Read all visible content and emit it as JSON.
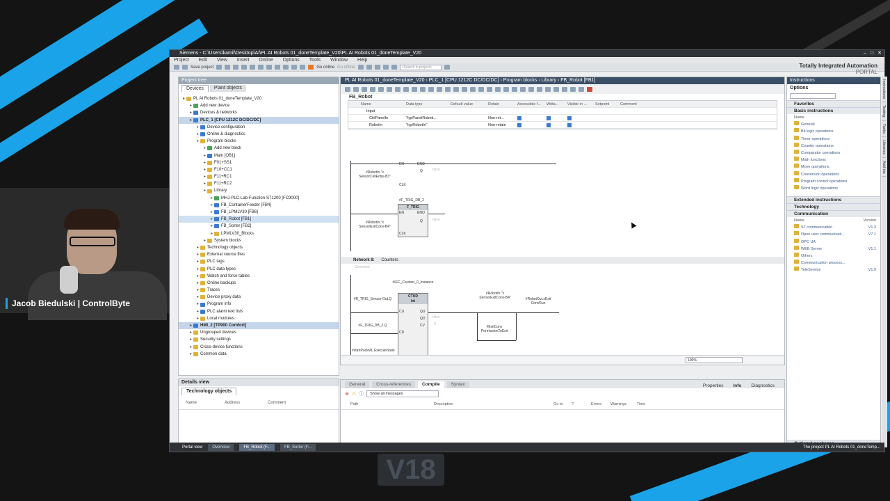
{
  "overlay": {
    "presenter": "Jacob Biedulski | ControlByte",
    "version_badge": "V18"
  },
  "window": {
    "title": "Siemens - C:\\Users\\kamil\\Desktop\\AI\\PL AI Robots 01_doneTemplate_V20\\PL AI Robots 01_doneTemplate_V20",
    "brand_line1": "Totally Integrated Automation",
    "brand_line2": "PORTAL"
  },
  "menu": [
    "Project",
    "Edit",
    "View",
    "Insert",
    "Online",
    "Options",
    "Tools",
    "Window",
    "Help"
  ],
  "toolbar": {
    "save_project": "Save project",
    "go_online": "Go online",
    "go_offline": "Go offline",
    "search_placeholder": "<Search in project>"
  },
  "project_tree": {
    "header": "Project tree",
    "tab_devices": "Devices",
    "tab_plant": "Plant objects",
    "items": [
      {
        "label": "PL AI Robots 01_doneTemplate_V20",
        "indent": 0,
        "icon": "y"
      },
      {
        "label": "Add new device",
        "indent": 1,
        "icon": "g"
      },
      {
        "label": "Devices & networks",
        "indent": 1,
        "icon": "b"
      },
      {
        "label": "PLC_1 [CPU 1212C DC/DC/DC]",
        "indent": 1,
        "icon": "b",
        "state": "hi"
      },
      {
        "label": "Device configuration",
        "indent": 2,
        "icon": "b"
      },
      {
        "label": "Online & diagnostics",
        "indent": 2,
        "icon": "b"
      },
      {
        "label": "Program blocks",
        "indent": 2,
        "icon": "y"
      },
      {
        "label": "Add new block",
        "indent": 3,
        "icon": "g"
      },
      {
        "label": "Main [OB1]",
        "indent": 3,
        "icon": "b"
      },
      {
        "label": "F01+SS1",
        "indent": 3,
        "icon": "y"
      },
      {
        "label": "F10+CC1",
        "indent": 3,
        "icon": "y"
      },
      {
        "label": "F11+RC1",
        "indent": 3,
        "icon": "y"
      },
      {
        "label": "F11+RC2",
        "indent": 3,
        "icon": "y"
      },
      {
        "label": "Library",
        "indent": 3,
        "icon": "y"
      },
      {
        "label": "MHJ-PLC-Lab-Function-S71200 [FC9000]",
        "indent": 4,
        "icon": "g"
      },
      {
        "label": "FB_ContainerFeeder [FB4]",
        "indent": 4,
        "icon": "b"
      },
      {
        "label": "FB_LPMLV30 [FB6]",
        "indent": 4,
        "icon": "b"
      },
      {
        "label": "FB_Robot [FB1]",
        "indent": 4,
        "icon": "b",
        "state": "sel"
      },
      {
        "label": "FB_Sorter [FB2]",
        "indent": 4,
        "icon": "b"
      },
      {
        "label": "LPMLV30_Blocks",
        "indent": 4,
        "icon": "y"
      },
      {
        "label": "System blocks",
        "indent": 3,
        "icon": "y"
      },
      {
        "label": "Technology objects",
        "indent": 2,
        "icon": "y"
      },
      {
        "label": "External source files",
        "indent": 2,
        "icon": "y"
      },
      {
        "label": "PLC tags",
        "indent": 2,
        "icon": "y"
      },
      {
        "label": "PLC data types",
        "indent": 2,
        "icon": "y"
      },
      {
        "label": "Watch and force tables",
        "indent": 2,
        "icon": "y"
      },
      {
        "label": "Online backups",
        "indent": 2,
        "icon": "y"
      },
      {
        "label": "Traces",
        "indent": 2,
        "icon": "y"
      },
      {
        "label": "Device proxy data",
        "indent": 2,
        "icon": "y"
      },
      {
        "label": "Program info",
        "indent": 2,
        "icon": "b"
      },
      {
        "label": "PLC alarm text lists",
        "indent": 2,
        "icon": "b"
      },
      {
        "label": "Local modules",
        "indent": 2,
        "icon": "y"
      },
      {
        "label": "HMI_2 [TP900 Comfort]",
        "indent": 1,
        "icon": "b",
        "state": "hi"
      },
      {
        "label": "Ungrouped devices",
        "indent": 1,
        "icon": "y"
      },
      {
        "label": "Security settings",
        "indent": 1,
        "icon": "y"
      },
      {
        "label": "Cross-device functions",
        "indent": 1,
        "icon": "y"
      },
      {
        "label": "Common data",
        "indent": 1,
        "icon": "y"
      }
    ]
  },
  "details_view": {
    "header": "Details view",
    "tab": "Technology objects",
    "columns": [
      "Name",
      "Address",
      "Comment"
    ]
  },
  "editor": {
    "breadcrumb": "PL AI Robots 01_doneTemplate_V20 › PLC_1 [CPU 1212C DC/DC/DC] › Program blocks › Library › FB_Robot [FB1]",
    "block_name": "FB_Robot",
    "interface_columns": [
      "Name",
      "Data type",
      "Default value",
      "Retain",
      "Accessible f...",
      "Writa...",
      "Visible in ...",
      "Setpoint",
      "Comment"
    ],
    "interface_rows": [
      {
        "name": "Input",
        "type": "",
        "retain": ""
      },
      {
        "name": "CtrlPanelIn",
        "type": "\"typPanelRoboti...",
        "retain": "Non-ret..."
      },
      {
        "name": "RobotIn",
        "type": "\"typRobotIn\"",
        "retain": "Non-retain"
      }
    ],
    "network8_title": "Network 8:",
    "network8_name": "Counters",
    "network8_comment": "Comment",
    "trig1_sensor": "#RobotIn.\"x SensorCellEntry-B3\"",
    "trig2_instance": "#F_TRIG_DB_2",
    "trig2_type": "F_TRIG",
    "trig2_sensor": "#RobotIn.\"x SensorExitConv-B4\"",
    "q_false": "false",
    "ctr_instance": "#IEC_Counter_0_Instance",
    "ctr_type": "CTUD",
    "ctr_int": "Int",
    "cu_in": "#R_TRIG_Sensor Out.Q",
    "cd_in": "#F_TRIG_DB_2.Q",
    "ld_in": "#startPackML.ExecuteState",
    "qu_out": "false",
    "cv_out": "0",
    "contact1": "#RobotIn.\"x SensorExitConv-B4\"",
    "contact2": "#ExitConv PermissionToExit",
    "coil": "#RobotOut.xExit ConvRun",
    "pin_en": "EN",
    "pin_eno": "ENO",
    "pin_q": "Q",
    "pin_clk": "CLK",
    "pin_cu": "CU",
    "pin_cd": "CD",
    "pin_qu": "QU",
    "pin_qd": "QD",
    "pin_cv": "CV",
    "zoom": "100%"
  },
  "inspector": {
    "tabs": [
      "General",
      "Cross-references",
      "Compile",
      "Syntax"
    ],
    "active": "Compile",
    "right_tabs": [
      "Properties",
      "Info",
      "Diagnostics"
    ],
    "filter": "Show all messages",
    "columns": [
      "Path",
      "Description",
      "Go to",
      "?",
      "Errors",
      "Warnings",
      "Time"
    ]
  },
  "instructions": {
    "header": "Instructions",
    "options": "Options",
    "favorites": "Favorites",
    "basic": "Basic instructions",
    "basic_col": "Name",
    "basic_items": [
      "General",
      "Bit logic operations",
      "Timer operations",
      "Counter operations",
      "Comparator operations",
      "Math functions",
      "Move operations",
      "Conversion operations",
      "Program control operations",
      "Word logic operations"
    ],
    "extended": "Extended instructions",
    "technology": "Technology",
    "communication": "Communication",
    "comm_cols": [
      "Name",
      "Version"
    ],
    "comm_items": [
      {
        "name": "S7 communication",
        "ver": "V1.3"
      },
      {
        "name": "Open user communicati...",
        "ver": "V7.1"
      },
      {
        "name": "OPC UA",
        "ver": ""
      },
      {
        "name": "WEB Server",
        "ver": "V1.1"
      },
      {
        "name": "Others",
        "ver": ""
      },
      {
        "name": "Communication process...",
        "ver": ""
      },
      {
        "name": "TeleService",
        "ver": "V1.9"
      }
    ],
    "optional": "Optional packages",
    "side_tabs": [
      "Instructions",
      "Testing",
      "Tasks",
      "Libraries",
      "Add-ins"
    ]
  },
  "statusbar": {
    "portal_view": "Portal view",
    "tabs": [
      "Overview",
      "FB_Robot (F...",
      "FB_Sorter (F..."
    ],
    "message": "The project PL AI Robots 01_doneTemp..."
  }
}
